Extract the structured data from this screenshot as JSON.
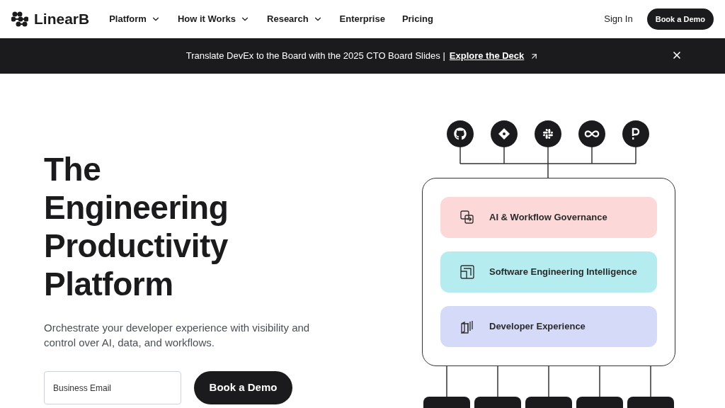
{
  "nav": {
    "logo": "LinearB",
    "links": [
      {
        "label": "Platform",
        "dropdown": true
      },
      {
        "label": "How it Works",
        "dropdown": true
      },
      {
        "label": "Research",
        "dropdown": true
      },
      {
        "label": "Enterprise",
        "dropdown": false
      },
      {
        "label": "Pricing",
        "dropdown": false
      }
    ],
    "sign_in": "Sign In",
    "cta": "Book a Demo"
  },
  "banner": {
    "text": "Translate DevEx to the Board with the 2025 CTO Board Slides |",
    "link": "Explore the Deck"
  },
  "hero": {
    "title_lines": [
      "The",
      "Engineering",
      "Productivity",
      "Platform"
    ],
    "subtitle": "Orchestrate your developer experience with visibility and control over AI, data, and workflows.",
    "email": {
      "placeholder": "Business Email"
    },
    "cta": "Book a Demo"
  },
  "diagram": {
    "integrations": [
      {
        "kind": "github"
      },
      {
        "kind": "diamond"
      },
      {
        "kind": "slack"
      },
      {
        "kind": "infinity"
      },
      {
        "kind": "p"
      }
    ],
    "layers": [
      {
        "label": "AI & Workflow Governance",
        "color": "#fdd8d8",
        "kind": "governance"
      },
      {
        "label": "Software Engineering Intelligence",
        "color": "#b5ecef",
        "kind": "intelligence"
      },
      {
        "label": "Developer Experience",
        "color": "#d6daf9",
        "kind": "experience"
      }
    ]
  }
}
